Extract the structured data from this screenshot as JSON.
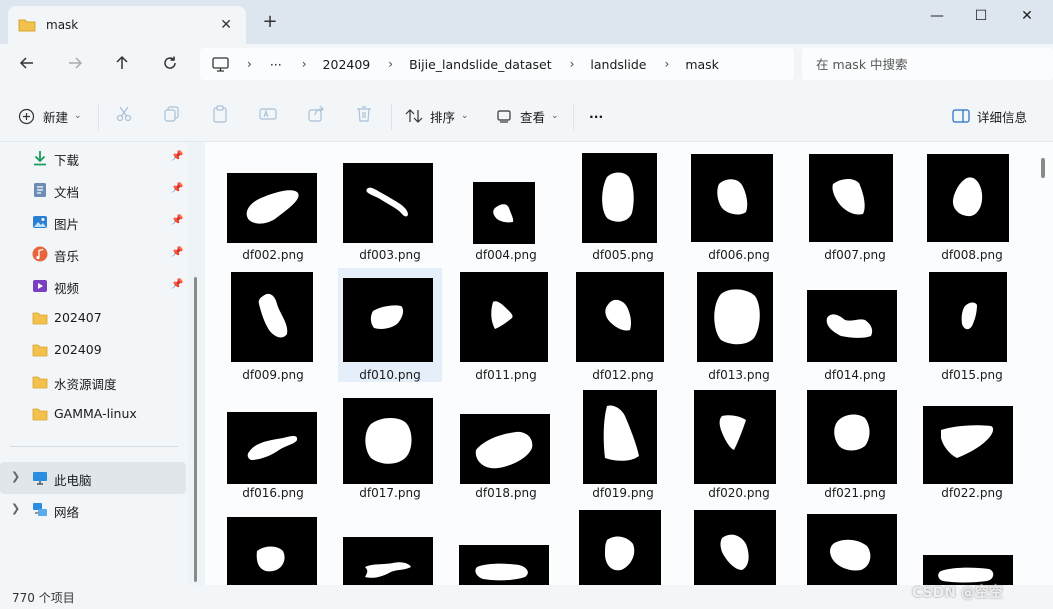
{
  "window": {
    "tab_title": "mask",
    "close_tab": "✕",
    "new_tab": "+",
    "minimize": "—",
    "maximize": "☐",
    "close": "✕"
  },
  "address": {
    "ellipsis": "···",
    "breadcrumbs": [
      "202409",
      "Bijie_landslide_dataset",
      "landslide",
      "mask"
    ],
    "separator": "›"
  },
  "search": {
    "placeholder": "在 mask 中搜索"
  },
  "toolbar": {
    "new_label": "新建",
    "sort_label": "排序",
    "view_label": "查看",
    "more_label": "···",
    "details_label": "详细信息"
  },
  "sidebar": {
    "items": [
      {
        "label": "下载",
        "icon": "download-icon",
        "pinned": true
      },
      {
        "label": "文档",
        "icon": "document-icon",
        "pinned": true
      },
      {
        "label": "图片",
        "icon": "pictures-icon",
        "pinned": true
      },
      {
        "label": "音乐",
        "icon": "music-icon",
        "pinned": true
      },
      {
        "label": "视频",
        "icon": "video-icon",
        "pinned": true
      },
      {
        "label": "202407",
        "icon": "folder-icon",
        "pinned": false
      },
      {
        "label": "202409",
        "icon": "folder-icon",
        "pinned": false
      },
      {
        "label": "水资源调度",
        "icon": "folder-icon",
        "pinned": false
      },
      {
        "label": "GAMMA-linux",
        "icon": "folder-icon",
        "pinned": false
      }
    ],
    "this_pc": "此电脑",
    "network": "网络"
  },
  "files": [
    "df002.png",
    "df003.png",
    "df004.png",
    "df005.png",
    "df006.png",
    "df007.png",
    "df008.png",
    "df009.png",
    "df010.png",
    "df011.png",
    "df012.png",
    "df013.png",
    "df014.png",
    "df015.png",
    "df016.png",
    "df017.png",
    "df018.png",
    "df019.png",
    "df020.png",
    "df021.png",
    "df022.png"
  ],
  "selected_file": "df010.png",
  "status": {
    "item_count": "770 个项目"
  },
  "watermark": "CSDN @空空"
}
